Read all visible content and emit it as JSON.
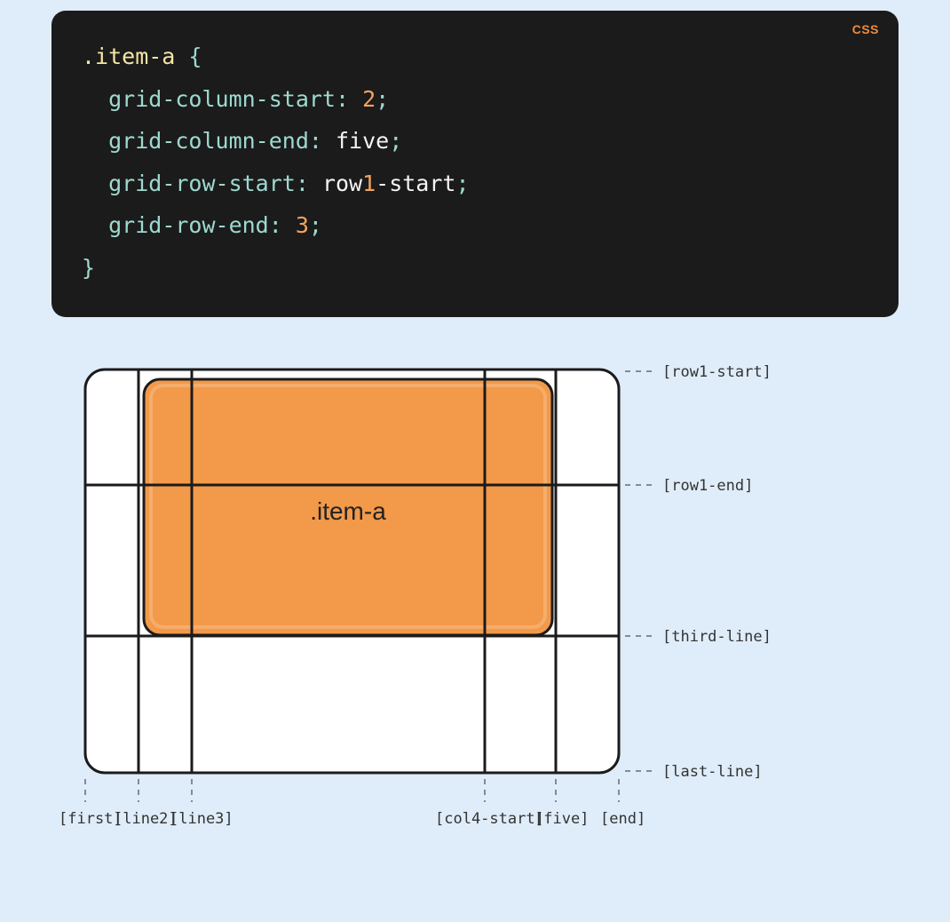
{
  "code": {
    "language_badge": "CSS",
    "selector": ".item-a",
    "open_brace": " {",
    "close_brace": "}",
    "lines": [
      {
        "prop": "grid-column-start",
        "colon": ": ",
        "value_parts": [
          {
            "t": "num",
            "v": "2"
          }
        ],
        "semi": ";"
      },
      {
        "prop": "grid-column-end",
        "colon": ": ",
        "value_parts": [
          {
            "t": "val",
            "v": "five"
          }
        ],
        "semi": ";"
      },
      {
        "prop": "grid-row-start",
        "colon": ": ",
        "value_parts": [
          {
            "t": "val",
            "v": "row"
          },
          {
            "t": "num",
            "v": "1"
          },
          {
            "t": "val",
            "v": "-start"
          }
        ],
        "semi": ";"
      },
      {
        "prop": "grid-row-end",
        "colon": ": ",
        "value_parts": [
          {
            "t": "num",
            "v": "3"
          }
        ],
        "semi": ";"
      }
    ]
  },
  "diagram": {
    "item_label": ".item-a",
    "row_labels": [
      "[row1-start]",
      "[row1-end]",
      "[third-line]",
      "[last-line]"
    ],
    "col_labels": [
      "[first]",
      "[line2]",
      "[line3]",
      "[col4-start]",
      "[five]",
      "[end]"
    ]
  }
}
